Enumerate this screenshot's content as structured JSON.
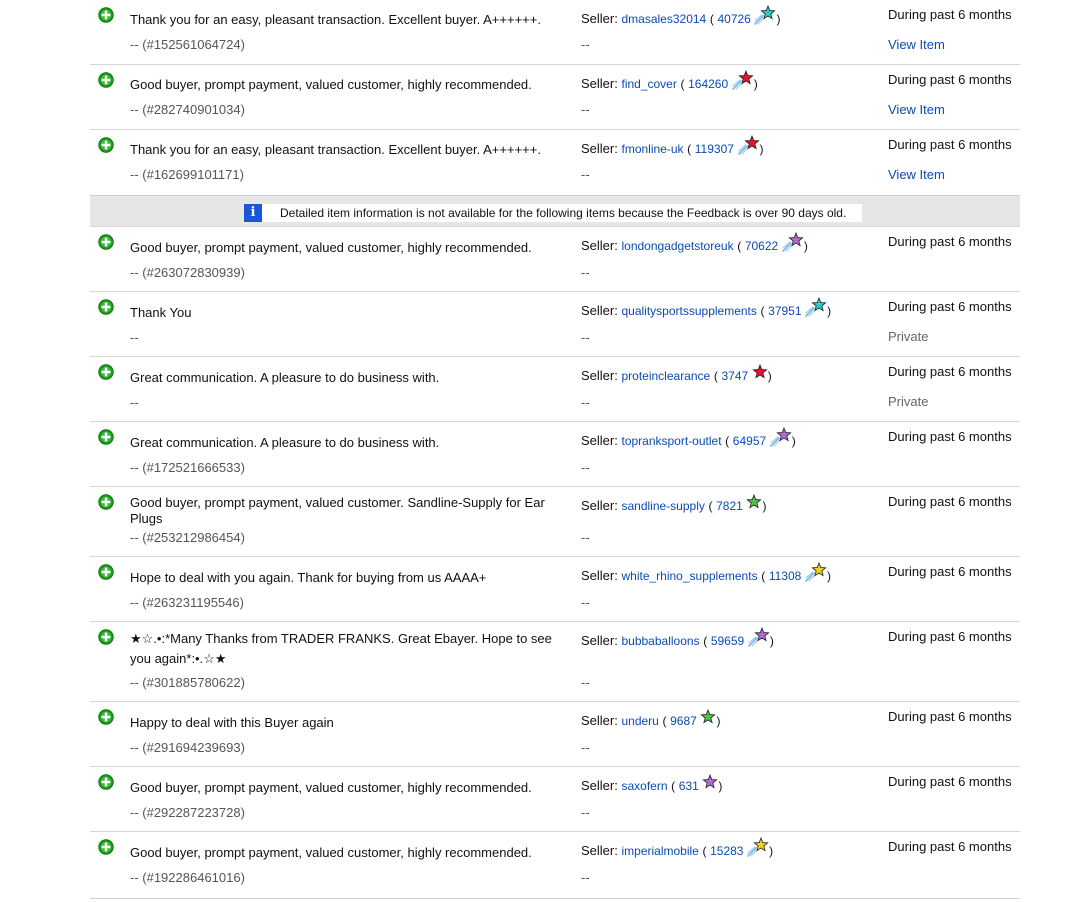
{
  "labels": {
    "seller": "Seller:",
    "dash": "--"
  },
  "notice": {
    "icon": "i",
    "text": "Detailed item information is not available for the following items because the Feedback is over 90 days old."
  },
  "rows": [
    {
      "comment": "Thank you for an easy, pleasant transaction. Excellent buyer. A++++++.",
      "item": "-- (#152561064724)",
      "seller": "dmasales32014",
      "score": "40726",
      "star": "turquoise-shooting-star-icon",
      "star_color": "#2ec9c9",
      "period": "During past 6 months",
      "link": "View Item"
    },
    {
      "comment": "Good buyer, prompt payment, valued customer, highly recommended.",
      "item": "-- (#282740901034)",
      "seller": "find_cover",
      "score": "164260",
      "star": "red-shooting-star-icon",
      "star_color": "#e0162b",
      "period": "During past 6 months",
      "link": "View Item"
    },
    {
      "comment": "Thank you for an easy, pleasant transaction. Excellent buyer. A++++++.",
      "item": "-- (#162699101171)",
      "seller": "fmonline-uk",
      "score": "119307",
      "star": "red-shooting-star-icon",
      "star_color": "#e0162b",
      "period": "During past 6 months",
      "link": "View Item"
    },
    {
      "comment": "Good buyer, prompt payment, valued customer, highly recommended.",
      "item": "-- (#263072830939)",
      "seller": "londongadgetstoreuk",
      "score": "70622",
      "star": "purple-shooting-star-icon",
      "star_color": "#b06ad9",
      "period": "During past 6 months"
    },
    {
      "comment": "Thank You",
      "item": "--",
      "seller": "qualitysportssupplements",
      "score": "37951",
      "star": "turquoise-shooting-star-icon",
      "star_color": "#2ec9c9",
      "period": "During past 6 months",
      "private": "Private"
    },
    {
      "comment": "Great communication. A pleasure to do business with.",
      "item": "--",
      "seller": "proteinclearance",
      "score": "3747",
      "star": "red-star-icon",
      "star_color": "#e0162b",
      "period": "During past 6 months",
      "private": "Private"
    },
    {
      "comment": "Great communication. A pleasure to do business with.",
      "item": "-- (#172521666533)",
      "seller": "topranksport-outlet",
      "score": "64957",
      "star": "purple-shooting-star-icon",
      "star_color": "#b06ad9",
      "period": "During past 6 months"
    },
    {
      "comment": "Good buyer, prompt payment, valued customer. Sandline-Supply for Ear Plugs",
      "item": "-- (#253212986454)",
      "seller": "sandline-supply",
      "score": "7821",
      "star": "green-star-icon",
      "star_color": "#4ec24a",
      "period": "During past 6 months"
    },
    {
      "comment": "Hope to deal with you again. Thank for buying from us AAAA+",
      "item": "-- (#263231195546)",
      "seller": "white_rhino_supplements",
      "score": "11308",
      "star": "yellow-shooting-star-icon",
      "star_color": "#f2d21b",
      "period": "During past 6 months"
    },
    {
      "comment": "★☆.•:*Many Thanks from TRADER FRANKS. Great Ebayer. Hope to see you again*:•.☆★",
      "item": "-- (#301885780622)",
      "seller": "bubbaballoons",
      "score": "59659",
      "star": "purple-shooting-star-icon",
      "star_color": "#b06ad9",
      "period": "During past 6 months"
    },
    {
      "comment": "Happy to deal with this Buyer again",
      "item": "-- (#291694239693)",
      "seller": "underu",
      "score": "9687",
      "star": "green-star-icon",
      "star_color": "#4ec24a",
      "period": "During past 6 months"
    },
    {
      "comment": "Good buyer, prompt payment, valued customer, highly recommended.",
      "item": "-- (#292287223728)",
      "seller": "saxofern",
      "score": "631",
      "star": "purple-star-icon",
      "star_color": "#b06ad9",
      "period": "During past 6 months"
    },
    {
      "comment": "Good buyer, prompt payment, valued customer, highly recommended.",
      "item": "-- (#192286461016)",
      "seller": "imperialmobile",
      "score": "15283",
      "star": "yellow-shooting-star-icon",
      "star_color": "#f2d21b",
      "period": "During past 6 months"
    }
  ]
}
